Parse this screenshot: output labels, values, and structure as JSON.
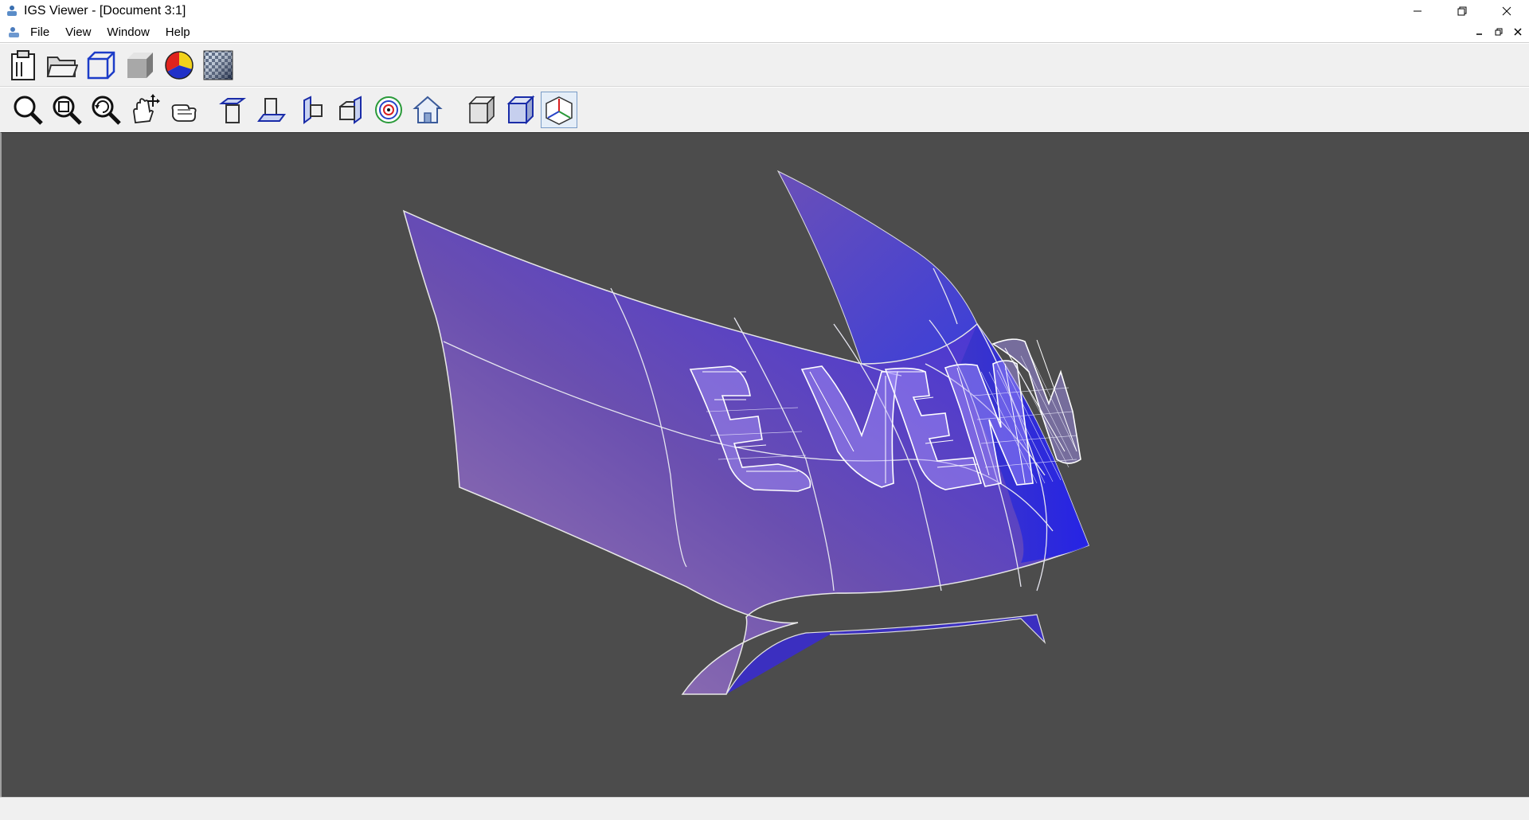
{
  "window": {
    "title": "IGS Viewer - [Document 3:1]",
    "controls": [
      "minimize",
      "restore",
      "close"
    ]
  },
  "menu": {
    "items": [
      "File",
      "View",
      "Window",
      "Help"
    ]
  },
  "toolbar_main": {
    "buttons": [
      "paste-icon",
      "open-folder-icon",
      "wireframe-box-icon",
      "shaded-box-icon",
      "color-wheel-icon",
      "texture-icon"
    ]
  },
  "toolbar_view": {
    "buttons": [
      "zoom-icon",
      "zoom-window-icon",
      "zoom-fit-icon",
      "pan-icon",
      "rotate-hand-icon",
      "top-view-icon",
      "front-view-icon",
      "side-view-icon",
      "iso-view-icon",
      "target-icon",
      "home-icon",
      "solid-mode-icon",
      "wire-solid-mode-icon",
      "axis-mode-icon"
    ],
    "active": "axis-mode-icon"
  },
  "model": {
    "text": "EVENT",
    "surface_color_start": "#8f76ad",
    "surface_color_end": "#3a2ae8"
  },
  "colors": {
    "viewport_bg": "#4c4c4c",
    "toolbar_bg": "#f0f0f0"
  }
}
